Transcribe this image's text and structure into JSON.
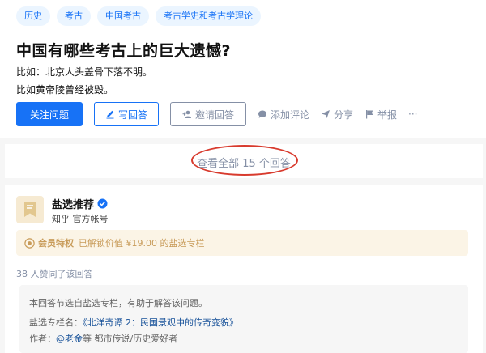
{
  "tags": [
    "历史",
    "考古",
    "中国考古",
    "考古学史和考古学理论"
  ],
  "question": {
    "title": "中国有哪些考古上的巨大遗憾?",
    "detail_lines": [
      "比如：北京人头盖骨下落不明。",
      "比如黄帝陵曾经被毁。"
    ]
  },
  "actions": {
    "follow": "关注问题",
    "write": "写回答",
    "invite": "邀请回答",
    "comment": "添加评论",
    "share": "分享",
    "report": "举报",
    "more": "···"
  },
  "view_all": "查看全部 15 个回答",
  "answer": {
    "author_name": "盐选推荐",
    "author_desc": "知乎 官方帐号",
    "vip_label": "会员特权",
    "vip_text": "已解锁价值 ¥19.00 的盐选专栏",
    "voters": "38 人赞同了该回答",
    "note_line1": "本回答节选自盐选专栏，有助于解答该问题。",
    "column_label": "盐选专栏名：",
    "column_name": "《北洋奇谭 2：民国景观中的传奇变貌》",
    "author_label": "作者：",
    "author_link": "@老金",
    "author_suffix": "等 都市传说/历史爱好者"
  },
  "colors": {
    "brand": "#1772f6",
    "muted": "#8590a6",
    "vip": "#c89b59",
    "highlight_circle": "#d83b2e"
  },
  "icons": [
    "pencil-icon",
    "invite-icon",
    "comment-icon",
    "share-icon",
    "flag-icon",
    "verified-icon",
    "bookmark-icon",
    "vip-badge-icon"
  ]
}
